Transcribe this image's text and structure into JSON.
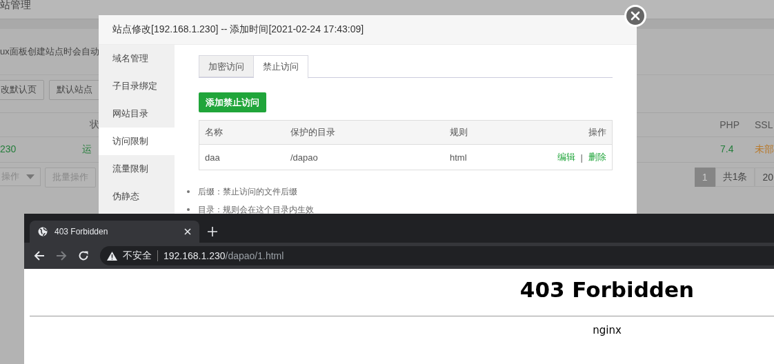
{
  "background_page": {
    "title": "站管理",
    "notice": "ux面板创建站点时会自动",
    "buttons": [
      "改默认页",
      "默认站点"
    ],
    "table": {
      "left_columns": [
        "状"
      ],
      "right_columns": [
        "PHP",
        "SSL"
      ],
      "left_cells": [
        {
          "text": "230",
          "color": "#237d3a"
        },
        {
          "text": "运",
          "color": "#237d3a"
        }
      ],
      "right_cells": [
        {
          "text": "7.4",
          "color": "#237d3a"
        },
        {
          "text": "未部",
          "color": "#b8792a"
        }
      ]
    },
    "bulk_select": "操作",
    "bulk_button": "批量操作",
    "pagination": [
      {
        "label": "1",
        "selected": true
      },
      {
        "label": "共1条",
        "selected": false
      },
      {
        "label": "20",
        "selected": false
      }
    ]
  },
  "dialog": {
    "title": "站点修改[192.168.1.230] -- 添加时间[2021-02-24 17:43:09]",
    "sidebar": [
      {
        "label": "域名管理",
        "selected": false
      },
      {
        "label": "子目录绑定",
        "selected": false
      },
      {
        "label": "网站目录",
        "selected": false
      },
      {
        "label": "访问限制",
        "selected": true
      },
      {
        "label": "流量限制",
        "selected": false
      },
      {
        "label": "伪静态",
        "selected": false
      }
    ],
    "tabs": [
      {
        "label": "加密访问",
        "selected": false
      },
      {
        "label": "禁止访问",
        "selected": true
      }
    ],
    "add_button": "添加禁止访问",
    "table": {
      "columns": [
        "名称",
        "保护的目录",
        "规则",
        "操作"
      ],
      "rows": [
        {
          "cells": [
            "daa",
            "/dapao",
            "html"
          ],
          "actions": [
            "编辑",
            "删除"
          ],
          "separator": "|"
        }
      ]
    },
    "notes": [
      "后缀：禁止访问的文件后缀",
      "目录：规则会在这个目录内生效"
    ]
  },
  "browser": {
    "tab_title": "403 Forbidden",
    "security": "不安全",
    "url_host": "192.168.1.230",
    "url_path": "/dapao/1.html",
    "page": {
      "heading": "403 Forbidden",
      "footer": "nginx"
    }
  }
}
